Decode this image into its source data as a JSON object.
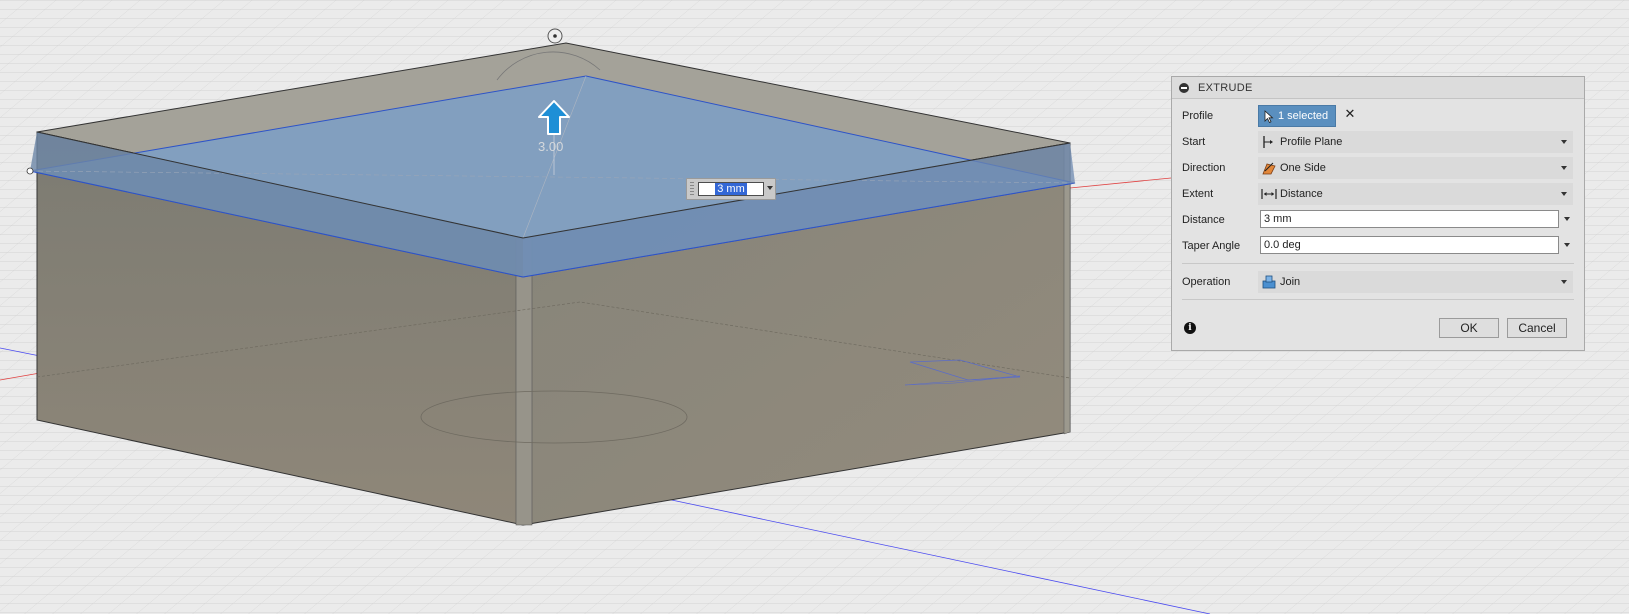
{
  "viewport": {
    "dimension_label": "3.00",
    "distance_input_value": "3 mm"
  },
  "panel": {
    "title": "EXTRUDE",
    "rows": {
      "profile": {
        "label": "Profile",
        "value": "1 selected"
      },
      "start": {
        "label": "Start",
        "value": "Profile Plane"
      },
      "direction": {
        "label": "Direction",
        "value": "One Side"
      },
      "extent": {
        "label": "Extent",
        "value": "Distance"
      },
      "distance": {
        "label": "Distance",
        "value": "3 mm"
      },
      "taper": {
        "label": "Taper Angle",
        "value": "0.0 deg"
      },
      "operation": {
        "label": "Operation",
        "value": "Join"
      }
    },
    "ok_label": "OK",
    "cancel_label": "Cancel"
  },
  "colors": {
    "selection_blue": "#5a8fbf",
    "manipulator_arrow": "#1e8fd6",
    "body_gray": "#8e8878"
  }
}
